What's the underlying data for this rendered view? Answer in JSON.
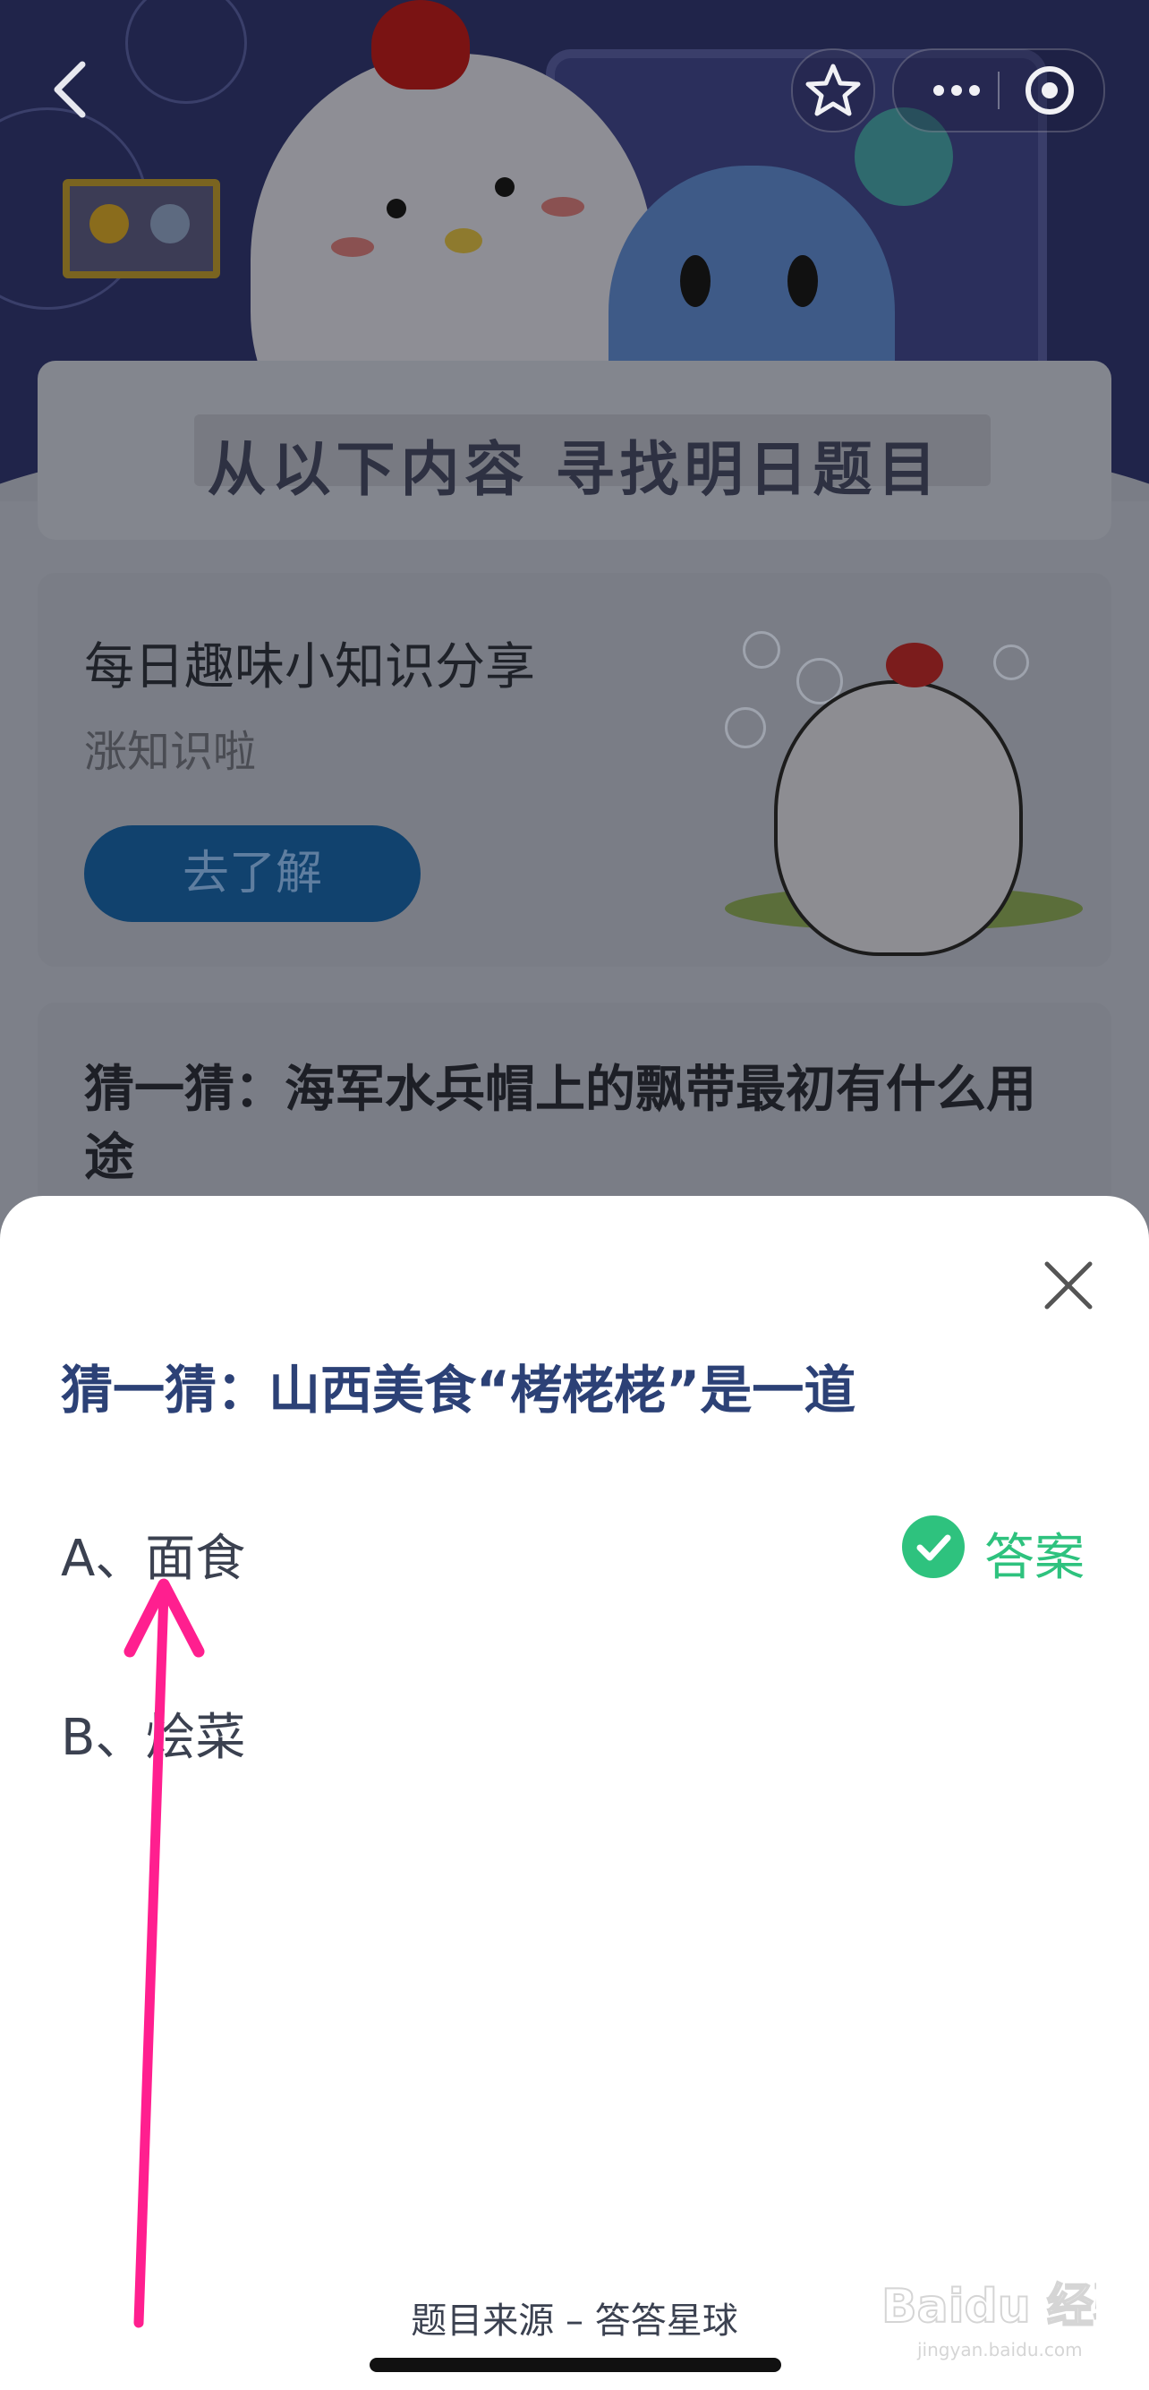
{
  "header": {
    "section_title": "从以下内容  寻找明日题目"
  },
  "cards": [
    {
      "title": "每日趣味小知识分享",
      "subtitle": "涨知识啦",
      "button": "去了解"
    },
    {
      "title": "猜一猜：海军水兵帽上的飘带最初有什么用途"
    }
  ],
  "sheet": {
    "question": "猜一猜：山西美食“栲栳栳”是一道",
    "options": [
      {
        "label": "A、面食"
      },
      {
        "label": "B、烩菜"
      }
    ],
    "answer_label": "答案",
    "source": "题目来源 – 答答星球"
  },
  "watermark": {
    "text": "Baidu 经验",
    "sub": "jingyan.baidu.com"
  },
  "colors": {
    "accent_blue": "#2c4176",
    "answer_green": "#2ec27e",
    "annotation_pink": "#ff1f8f"
  },
  "icons": [
    "back-icon",
    "star-icon",
    "more-icon",
    "target-icon",
    "close-icon",
    "check-icon"
  ]
}
